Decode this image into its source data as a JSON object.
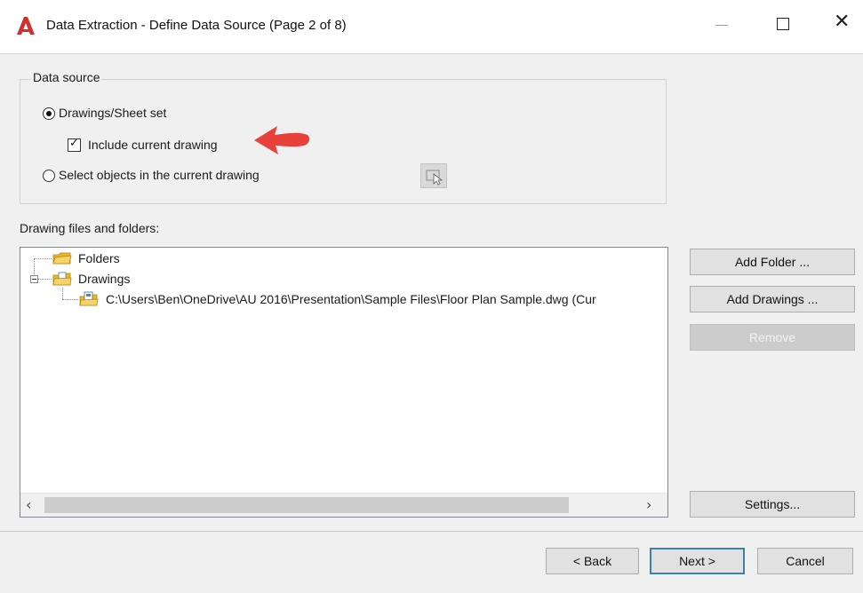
{
  "window": {
    "title": "Data Extraction - Define Data Source (Page 2 of 8)",
    "icon": "autocad-logo-icon",
    "controls": [
      "minimize",
      "maximize",
      "close"
    ]
  },
  "data_source": {
    "legend": "Data source",
    "option_drawings": "Drawings/Sheet set",
    "option_drawings_selected": true,
    "include_current_label": "Include current drawing",
    "include_current_checked": true,
    "option_select_objects": "Select objects in the current drawing",
    "option_select_objects_selected": false
  },
  "files": {
    "label": "Drawing files and folders:",
    "tree": [
      {
        "label": "Folders",
        "icon": "folder-icon",
        "level": 0
      },
      {
        "label": "Drawings",
        "icon": "drawings-folder-icon",
        "level": 0,
        "expanded": true
      },
      {
        "label": "C:\\Users\\Ben\\OneDrive\\AU 2016\\Presentation\\Sample Files\\Floor Plan Sample.dwg (Cur",
        "icon": "dwg-file-icon",
        "level": 1
      }
    ]
  },
  "side_buttons": {
    "add_folder": "Add Folder ...",
    "add_drawings": "Add Drawings ...",
    "remove": "Remove",
    "settings": "Settings..."
  },
  "footer": {
    "back": "< Back",
    "next": "Next >",
    "cancel": "Cancel"
  },
  "colors": {
    "accent_arrow": "#e8413c",
    "default_button_border": "#3c7fb1",
    "app_icon": "#d32f2f"
  }
}
